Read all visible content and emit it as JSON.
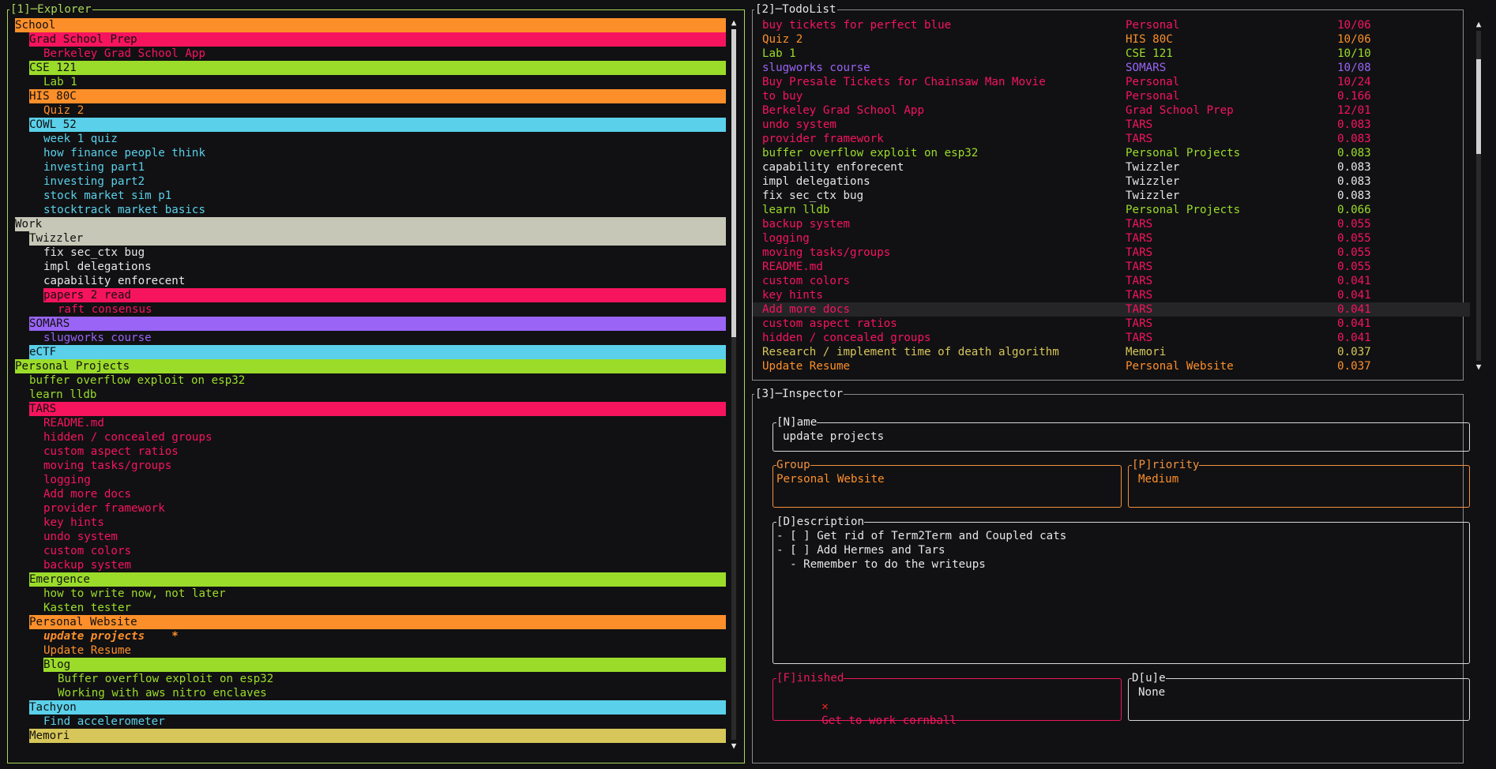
{
  "explorer": {
    "title": "[1]─Explorer",
    "items": [
      {
        "text": "School",
        "indent": 0,
        "bg": "#fd8f2a",
        "fg": "#111111"
      },
      {
        "text": "Grad School Prep",
        "indent": 1,
        "bg": "#f7145e",
        "fg": "#111111"
      },
      {
        "text": "Berkeley Grad School App",
        "indent": 2,
        "fg": "#f7145e"
      },
      {
        "text": "CSE 121",
        "indent": 1,
        "bg": "#9bdc2a",
        "fg": "#111111"
      },
      {
        "text": "Lab 1",
        "indent": 2,
        "fg": "#9bdc2a"
      },
      {
        "text": "HIS 80C",
        "indent": 1,
        "bg": "#fd8f2a",
        "fg": "#111111"
      },
      {
        "text": "Quiz 2",
        "indent": 2,
        "fg": "#fd8f2a"
      },
      {
        "text": "COWL 52",
        "indent": 1,
        "bg": "#5ad0ea",
        "fg": "#111111"
      },
      {
        "text": "week 1 quiz",
        "indent": 2,
        "fg": "#5ad0ea"
      },
      {
        "text": "how finance people think",
        "indent": 2,
        "fg": "#5ad0ea"
      },
      {
        "text": "investing part1",
        "indent": 2,
        "fg": "#5ad0ea"
      },
      {
        "text": "investing part2",
        "indent": 2,
        "fg": "#5ad0ea"
      },
      {
        "text": "stock market sim p1",
        "indent": 2,
        "fg": "#5ad0ea"
      },
      {
        "text": "stocktrack market basics",
        "indent": 2,
        "fg": "#5ad0ea"
      },
      {
        "text": "Work",
        "indent": 0,
        "bg": "#c6c7b6",
        "fg": "#111111"
      },
      {
        "text": "Twizzler",
        "indent": 1,
        "bg": "#c6c7b6",
        "fg": "#111111"
      },
      {
        "text": "fix sec_ctx bug",
        "indent": 2,
        "fg": "#e6e6e6"
      },
      {
        "text": "impl delegations",
        "indent": 2,
        "fg": "#e6e6e6"
      },
      {
        "text": "capability enforecent",
        "indent": 2,
        "fg": "#e6e6e6"
      },
      {
        "text": "papers 2 read",
        "indent": 2,
        "bg": "#f7145e",
        "fg": "#111111"
      },
      {
        "text": "raft consensus",
        "indent": 3,
        "fg": "#f7145e"
      },
      {
        "text": "SOMARS",
        "indent": 1,
        "bg": "#9a64f6",
        "fg": "#111111"
      },
      {
        "text": "slugworks course",
        "indent": 2,
        "fg": "#9a64f6"
      },
      {
        "text": "eCTF",
        "indent": 1,
        "bg": "#5ad0ea",
        "fg": "#111111"
      },
      {
        "text": "Personal Projects",
        "indent": 0,
        "bg": "#9bdc2a",
        "fg": "#111111"
      },
      {
        "text": "buffer overflow exploit on esp32",
        "indent": 1,
        "fg": "#9bdc2a"
      },
      {
        "text": "learn lldb",
        "indent": 1,
        "fg": "#9bdc2a"
      },
      {
        "text": "TARS",
        "indent": 1,
        "bg": "#f7145e",
        "fg": "#111111"
      },
      {
        "text": "README.md",
        "indent": 2,
        "fg": "#f7145e"
      },
      {
        "text": "hidden / concealed groups",
        "indent": 2,
        "fg": "#f7145e"
      },
      {
        "text": "custom aspect ratios",
        "indent": 2,
        "fg": "#f7145e"
      },
      {
        "text": "moving tasks/groups",
        "indent": 2,
        "fg": "#f7145e"
      },
      {
        "text": "logging",
        "indent": 2,
        "fg": "#f7145e"
      },
      {
        "text": "Add more docs",
        "indent": 2,
        "fg": "#f7145e"
      },
      {
        "text": "provider framework",
        "indent": 2,
        "fg": "#f7145e"
      },
      {
        "text": "key hints",
        "indent": 2,
        "fg": "#f7145e"
      },
      {
        "text": "undo system",
        "indent": 2,
        "fg": "#f7145e"
      },
      {
        "text": "custom colors",
        "indent": 2,
        "fg": "#f7145e"
      },
      {
        "text": "backup system",
        "indent": 2,
        "fg": "#f7145e"
      },
      {
        "text": "Emergence",
        "indent": 1,
        "bg": "#9bdc2a",
        "fg": "#111111"
      },
      {
        "text": "how to write now, not later",
        "indent": 2,
        "fg": "#9bdc2a"
      },
      {
        "text": "Kasten tester",
        "indent": 2,
        "fg": "#9bdc2a"
      },
      {
        "text": "Personal Website",
        "indent": 1,
        "bg": "#fd8f2a",
        "fg": "#111111"
      },
      {
        "text": "update projects    *",
        "indent": 2,
        "fg": "#fd8f2a",
        "italic": true
      },
      {
        "text": "Update Resume",
        "indent": 2,
        "fg": "#fd8f2a"
      },
      {
        "text": "Blog",
        "indent": 2,
        "bg": "#9bdc2a",
        "fg": "#111111"
      },
      {
        "text": "Buffer overflow exploit on esp32",
        "indent": 3,
        "fg": "#9bdc2a"
      },
      {
        "text": "Working with aws nitro enclaves",
        "indent": 3,
        "fg": "#9bdc2a"
      },
      {
        "text": "Tachyon",
        "indent": 1,
        "bg": "#5ad0ea",
        "fg": "#111111"
      },
      {
        "text": "Find accelerometer",
        "indent": 2,
        "fg": "#5ad0ea"
      },
      {
        "text": "Memori",
        "indent": 1,
        "bg": "#d7c659",
        "fg": "#111111"
      }
    ]
  },
  "todolist": {
    "title": "[2]─TodoList",
    "rows": [
      {
        "name": "buy tickets for perfect blue",
        "group": "Personal",
        "value": "10/06",
        "color": "#f7145e"
      },
      {
        "name": "Quiz 2",
        "group": "HIS 80C",
        "value": "10/06",
        "color": "#fd8f2a"
      },
      {
        "name": "Lab 1",
        "group": "CSE 121",
        "value": "10/10",
        "color": "#9bdc2a"
      },
      {
        "name": "slugworks course",
        "group": "SOMARS",
        "value": "10/08",
        "color": "#9a64f6"
      },
      {
        "name": "Buy Presale Tickets for Chainsaw Man Movie",
        "group": "Personal",
        "value": "10/24",
        "color": "#f7145e"
      },
      {
        "name": "to buy",
        "group": "Personal",
        "value": "0.166",
        "color": "#f7145e"
      },
      {
        "name": "Berkeley Grad School App",
        "group": "Grad School Prep",
        "value": "12/01",
        "color": "#f7145e"
      },
      {
        "name": "undo system",
        "group": "TARS",
        "value": "0.083",
        "color": "#f7145e"
      },
      {
        "name": "provider framework",
        "group": "TARS",
        "value": "0.083",
        "color": "#f7145e"
      },
      {
        "name": "buffer overflow exploit on esp32",
        "group": "Personal Projects",
        "value": "0.083",
        "color": "#9bdc2a"
      },
      {
        "name": "capability enforecent",
        "group": "Twizzler",
        "value": "0.083",
        "color": "#e6e6e6"
      },
      {
        "name": "impl delegations",
        "group": "Twizzler",
        "value": "0.083",
        "color": "#e6e6e6"
      },
      {
        "name": "fix sec_ctx bug",
        "group": "Twizzler",
        "value": "0.083",
        "color": "#e6e6e6"
      },
      {
        "name": "learn lldb",
        "group": "Personal Projects",
        "value": "0.066",
        "color": "#9bdc2a"
      },
      {
        "name": "backup system",
        "group": "TARS",
        "value": "0.055",
        "color": "#f7145e"
      },
      {
        "name": "logging",
        "group": "TARS",
        "value": "0.055",
        "color": "#f7145e"
      },
      {
        "name": "moving tasks/groups",
        "group": "TARS",
        "value": "0.055",
        "color": "#f7145e"
      },
      {
        "name": "README.md",
        "group": "TARS",
        "value": "0.055",
        "color": "#f7145e"
      },
      {
        "name": "custom colors",
        "group": "TARS",
        "value": "0.041",
        "color": "#f7145e"
      },
      {
        "name": "key hints",
        "group": "TARS",
        "value": "0.041",
        "color": "#f7145e"
      },
      {
        "name": "Add more docs",
        "group": "TARS",
        "value": "0.041",
        "color": "#f7145e",
        "highlight": true
      },
      {
        "name": "custom aspect ratios",
        "group": "TARS",
        "value": "0.041",
        "color": "#f7145e"
      },
      {
        "name": "hidden / concealed groups",
        "group": "TARS",
        "value": "0.041",
        "color": "#f7145e"
      },
      {
        "name": "Research / implement time of death algorithm",
        "group": "Memori",
        "value": "0.037",
        "color": "#d7c659"
      },
      {
        "name": "Update Resume",
        "group": "Personal Website",
        "value": "0.037",
        "color": "#fd8f2a"
      }
    ]
  },
  "inspector": {
    "title": "[3]─Inspector",
    "name_label": "[N]ame",
    "name_value": "update projects",
    "group_label": "Group",
    "group_value": "Personal Website",
    "priority_label": "[P]riority",
    "priority_value": "Medium",
    "description_label": "[D]escription",
    "description_lines": [
      "- [ ] Get rid of Term2Term and Coupled cats",
      "- [ ] Add Hermes and Tars",
      "  - Remember to do the writeups"
    ],
    "finished_label": "[F]inished",
    "finished_icon": "cross-mark",
    "finished_value": "Get to work cornball",
    "due_label": "D[u]e",
    "due_value": "None"
  },
  "colors": {
    "accent_green": "#a9d65a",
    "orange": "#f2913d",
    "red": "#ea1a5a",
    "panel_gray": "#8a8a8a"
  }
}
